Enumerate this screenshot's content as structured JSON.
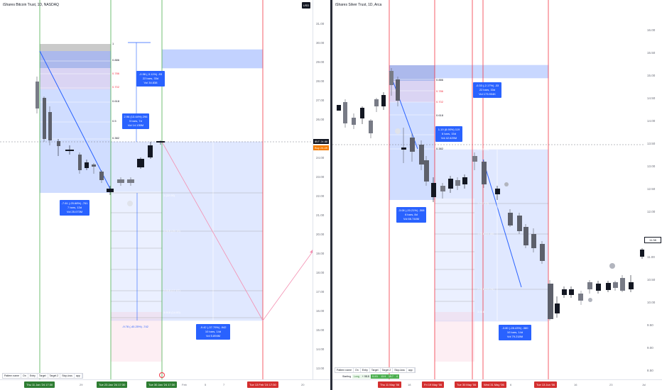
{
  "left": {
    "title": "iShares Bitcoin Trust, 1D, NASDAQ",
    "currency": "USD",
    "yticks": [
      "31.00",
      "30.00",
      "29.00",
      "28.00",
      "27.00",
      "26.00",
      "25.00",
      "24.00",
      "23.00",
      "22.00",
      "21.00",
      "20.00",
      "19.00",
      "18.00",
      "17.00",
      "16.00",
      "15.00",
      "14.00",
      "13.00"
    ],
    "price_tags": [
      {
        "label": "IBIT",
        "value": "24.88",
        "color": "#131722"
      },
      {
        "label": "Buy",
        "value": "24.49",
        "color": "#f57c00"
      }
    ],
    "xticks": [
      "29",
      "Feb",
      "5",
      "7",
      "12",
      "20"
    ],
    "xdates": [
      {
        "text": "Thu 11 Jan '24  17:30",
        "color": "#2e7d32"
      },
      {
        "text": "Tue 23 Jan '24  17:30",
        "color": "#2e7d32"
      },
      {
        "text": "Tue 30 Jan '24  17:30",
        "color": "#2e7d32"
      },
      {
        "text": "Tue 13 Feb '24  17:30",
        "color": "#d32f2f"
      }
    ],
    "stats": [
      {
        "lines": [
          "-0.98 (-3.11%) -93",
          "22 bars, 33d",
          "Vol 34.838"
        ]
      },
      {
        "lines": [
          "2.96 (13.44%) 296",
          "5 bars, 7d",
          "Vol 14.135M"
        ]
      },
      {
        "lines": [
          "-7.61 (-25.68%) -761",
          "7 bars, 13d",
          "Vol 25.073M"
        ]
      },
      {
        "lines": [
          "-9.42 (-37.79%) -942",
          "10 bars, 14d",
          "Vol 5.894M"
        ]
      }
    ],
    "fib_labels": [
      "1",
      "0.886",
      "0.786",
      "0.702",
      "0.618",
      "0.5",
      "0.382",
      "0 (25.00)",
      "1 (22.00)",
      "1.618 (20.15)",
      "2.618 (17.07)",
      "3.618 (14.00)"
    ],
    "toolbar": [
      "Pattern name",
      "On",
      "Entry",
      "Target",
      "Target 2",
      "Stop-loss",
      "app"
    ],
    "lower_label": "-9.78 (-40.25%) -742"
  },
  "right": {
    "title": "iShares Silver Trust, 1D, Arca",
    "currency": "USD",
    "yticks": [
      "16.00",
      "15.50",
      "15.00",
      "14.50",
      "14.00",
      "13.50",
      "13.00",
      "12.50",
      "12.00",
      "11.50",
      "11.00",
      "10.50",
      "10.00",
      "9.50",
      "9.00",
      "8.50"
    ],
    "price_tag": {
      "value": "11.38",
      "color": "#ffffff"
    },
    "xticks": [
      "May",
      "18",
      "25",
      "Jun",
      "6",
      "16",
      "23",
      "Jul"
    ],
    "xdates": [
      {
        "text": "Thu 11 May '06",
        "color": "#d32f2f"
      },
      {
        "text": "Fri 19 May '06",
        "color": "#d32f2f"
      },
      {
        "text": "Tue 30 May '06",
        "color": "#d32f2f"
      },
      {
        "text": "Wed 31 May '06",
        "color": "#d32f2f"
      },
      {
        "text": "Tue 13 Jun '06",
        "color": "#d32f2f"
      }
    ],
    "stats": [
      {
        "lines": [
          "-0.33 (-2.17%) -33",
          "22 bars, 33d",
          "Vol 173.904K"
        ]
      },
      {
        "lines": [
          "1.19 (8.90%) 119",
          "6 bars, 15d",
          "Vol 42.625M"
        ]
      },
      {
        "lines": [
          "-3.08 (-20.21%) -308",
          "6 bars, 8d",
          "Vol 66.744M"
        ]
      },
      {
        "lines": [
          "-3.80 (-28.43%) -380",
          "10 bars, 14d",
          "Vol 79.218M"
        ]
      }
    ],
    "fib_labels": [
      "0.886",
      "0.786",
      "0.702",
      "0.618",
      "0.5",
      "0.382",
      "0 (13.36)",
      "1 (12.15)",
      "1.618 (11.40)",
      "2.618 (10.24)",
      "3.618"
    ],
    "toolbar": [
      "Pattern name",
      "On",
      "Entry",
      "Target",
      "Target 2",
      "Stop-loss",
      "app"
    ],
    "strategy": [
      "Starting",
      "Long",
      "+ 98.8",
      "11.51",
      "13.9",
      "15.7",
      "4"
    ],
    "label_ebunomer": "Ebunomer"
  },
  "colors": {
    "green_line": "#4caf50",
    "red_line": "#f23645",
    "blue_box": "#2962ff",
    "stat_box": "#2962ff",
    "fib_red": "#f23645",
    "fib_orange": "#ff9800"
  }
}
